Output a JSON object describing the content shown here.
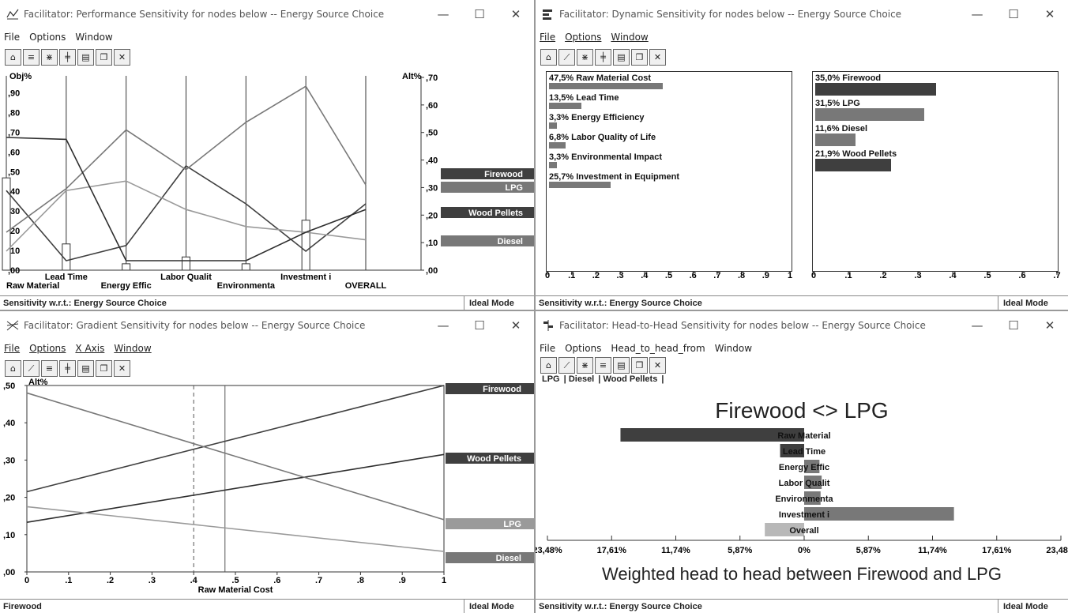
{
  "colors": {
    "firewood": "#3f3f3f",
    "lpg": "#787878",
    "diesel": "#9a9a9a",
    "wood_pellets": "#2e2e2e",
    "light": "#b8b8b8"
  },
  "perf": {
    "title": "Facilitator: Performance Sensitivity for nodes below -- Energy Source Choice",
    "menu": [
      "File",
      "Options",
      "Window"
    ],
    "left_axis_label": "Obj%",
    "right_axis_label": "Alt%",
    "left_ticks": [
      ",90",
      ",80",
      ",70",
      ",60",
      ",50",
      ",40",
      ",30",
      ",20",
      ",10",
      ",00"
    ],
    "right_ticks": [
      ",70",
      ",60",
      ",50",
      ",40",
      ",30",
      ",20",
      ",10",
      ",00"
    ],
    "x_labels": [
      "Raw Material",
      "Lead Time",
      "Energy Effic",
      "Labor Qualit",
      "Environmenta",
      "Investment i",
      "OVERALL"
    ],
    "legend": [
      "Firewood",
      "LPG",
      "Wood Pellets",
      "Diesel"
    ],
    "status": "Sensitivity w.r.t.: Energy Source Choice",
    "mode": "Ideal Mode"
  },
  "dyn": {
    "title": "Facilitator: Dynamic Sensitivity for nodes below -- Energy Source Choice",
    "menu": [
      "File",
      "Options",
      "Window"
    ],
    "criteria": [
      "47,5% Raw Material Cost",
      "13,5% Lead Time",
      "3,3% Energy Efficiency",
      "6,8% Labor Quality of Life",
      "3,3% Environmental Impact",
      "25,7% Investment in Equipment"
    ],
    "criteria_values": [
      0.475,
      0.135,
      0.033,
      0.068,
      0.033,
      0.257
    ],
    "alternatives": [
      "35,0% Firewood",
      "31,5% LPG",
      "11,6% Diesel",
      "21,9% Wood Pellets"
    ],
    "alternatives_values": [
      0.35,
      0.315,
      0.116,
      0.219
    ],
    "left_axis": [
      "0",
      ".1",
      ".2",
      ".3",
      ".4",
      ".5",
      ".6",
      ".7",
      ".8",
      ".9",
      "1"
    ],
    "right_axis": [
      "0",
      ".1",
      ".2",
      ".3",
      ".4",
      ".5",
      ".6",
      ".7"
    ],
    "status": "Sensitivity w.r.t.: Energy Source Choice",
    "mode": "Ideal Mode"
  },
  "grad": {
    "title": "Facilitator: Gradient Sensitivity for nodes below -- Energy Source Choice",
    "menu": [
      "File",
      "Options",
      "X Axis",
      "Window"
    ],
    "y_label": "Alt%",
    "y_ticks": [
      ",50",
      ",40",
      ",30",
      ",20",
      ",10",
      ",00"
    ],
    "x_ticks": [
      "0",
      ".1",
      ".2",
      ".3",
      ".4",
      ".5",
      ".6",
      ".7",
      ".8",
      ".9",
      "1"
    ],
    "x_label": "Raw Material Cost",
    "legend": [
      "Firewood",
      "Wood Pellets",
      "LPG",
      "Diesel"
    ],
    "status": "Firewood",
    "mode": "Ideal Mode"
  },
  "h2h": {
    "title": "Facilitator: Head-to-Head Sensitivity for nodes below -- Energy Source Choice",
    "menu": [
      "File",
      "Options",
      "Head_to_head_from",
      "Window"
    ],
    "tabs": [
      "LPG",
      "Diesel",
      "Wood Pellets"
    ],
    "heading": "Firewood <> LPG",
    "rows": [
      "Raw Material",
      "Lead Time",
      "Energy Effic",
      "Labor Qualit",
      "Environmenta",
      "Investment i",
      "Overall"
    ],
    "axis": [
      "23,48%",
      "17,61%",
      "11,74%",
      "5,87%",
      "0%",
      "5,87%",
      "11,74%",
      "17,61%",
      "23,48%"
    ],
    "caption": "Weighted head to head between Firewood and LPG",
    "status": "Sensitivity w.r.t.: Energy Source Choice",
    "mode": "Ideal Mode"
  },
  "chart_data": [
    {
      "type": "line",
      "name_ref": "perf",
      "categories": [
        "Raw Material",
        "Lead Time",
        "Energy Effic",
        "Labor Qualit",
        "Environmenta",
        "Investment i",
        "OVERALL"
      ],
      "priority_bars": [
        0.475,
        0.135,
        0.033,
        0.068,
        0.033,
        0.257
      ],
      "series": [
        {
          "name": "Firewood",
          "values": [
            0.42,
            0.05,
            0.13,
            0.55,
            0.35,
            0.1,
            0.35
          ]
        },
        {
          "name": "LPG",
          "values": [
            0.2,
            0.43,
            0.74,
            0.53,
            0.78,
            0.97,
            0.45
          ]
        },
        {
          "name": "Diesel",
          "values": [
            0.1,
            0.42,
            0.47,
            0.32,
            0.23,
            0.2,
            0.16
          ]
        },
        {
          "name": "Wood Pellets",
          "values": [
            0.7,
            0.69,
            0.05,
            0.05,
            0.05,
            0.2,
            0.32
          ]
        }
      ]
    },
    {
      "type": "line",
      "name_ref": "grad",
      "xlabel": "Raw Material Cost",
      "ylabel": "Alt%",
      "ylim": [
        0,
        0.5
      ],
      "xlim": [
        0,
        1
      ],
      "current_x": 0.475,
      "original_x": 0.4,
      "series": [
        {
          "name": "Firewood",
          "x": [
            0,
            1
          ],
          "y": [
            0.215,
            0.5
          ]
        },
        {
          "name": "Wood Pellets",
          "x": [
            0,
            1
          ],
          "y": [
            0.133,
            0.315
          ]
        },
        {
          "name": "LPG",
          "x": [
            0,
            1
          ],
          "y": [
            0.48,
            0.14
          ]
        },
        {
          "name": "Diesel",
          "x": [
            0,
            1
          ],
          "y": [
            0.175,
            0.055
          ]
        }
      ]
    },
    {
      "type": "bar",
      "name_ref": "h2h",
      "categories": [
        "Raw Material",
        "Lead Time",
        "Energy Effic",
        "Labor Qualit",
        "Environmenta",
        "Investment i",
        "Overall"
      ],
      "values": [
        -16.8,
        -2.2,
        1.4,
        1.6,
        1.5,
        13.7,
        -3.6
      ],
      "xlim": [
        -23.48,
        23.48
      ]
    }
  ]
}
